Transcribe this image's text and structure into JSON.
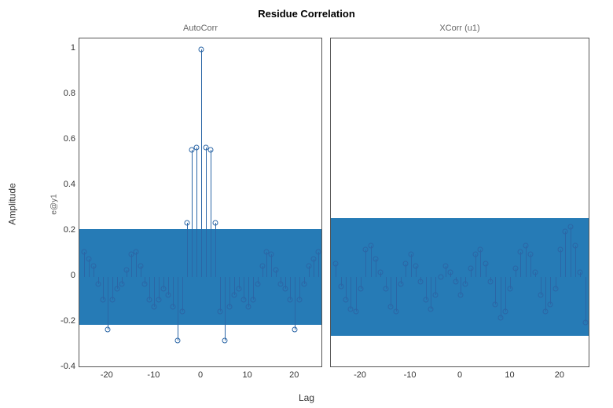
{
  "suptitle": "Residue Correlation",
  "ylabel_outer": "Amplitude",
  "ylabel_inner": "e@y1",
  "xlabel": "Lag",
  "subplots": {
    "left": {
      "title": "AutoCorr"
    },
    "right": {
      "title": "XCorr (u1)"
    }
  },
  "yticks": [
    {
      "v": -0.4,
      "label": "-0.4"
    },
    {
      "v": -0.2,
      "label": "-0.2"
    },
    {
      "v": 0.0,
      "label": "0"
    },
    {
      "v": 0.2,
      "label": "0.2"
    },
    {
      "v": 0.4,
      "label": "0.4"
    },
    {
      "v": 0.6,
      "label": "0.6"
    },
    {
      "v": 0.8,
      "label": "0.8"
    },
    {
      "v": 1.0,
      "label": "1"
    }
  ],
  "xticks": [
    {
      "v": -20,
      "label": "-20"
    },
    {
      "v": -10,
      "label": "-10"
    },
    {
      "v": 0,
      "label": "0"
    },
    {
      "v": 10,
      "label": "10"
    },
    {
      "v": 20,
      "label": "20"
    }
  ],
  "chart_data": [
    {
      "type": "stem",
      "title": "AutoCorr",
      "xlabel": "Lag",
      "ylabel": "Amplitude",
      "xlim": [
        -26,
        26
      ],
      "ylim": [
        -0.4,
        1.05
      ],
      "confidence_band": [
        -0.21,
        0.21
      ],
      "lags": [
        -25,
        -24,
        -23,
        -22,
        -21,
        -20,
        -19,
        -18,
        -17,
        -16,
        -15,
        -14,
        -13,
        -12,
        -11,
        -10,
        -9,
        -8,
        -7,
        -6,
        -5,
        -4,
        -3,
        -2,
        -1,
        0,
        1,
        2,
        3,
        4,
        5,
        6,
        7,
        8,
        9,
        10,
        11,
        12,
        13,
        14,
        15,
        16,
        17,
        18,
        19,
        20,
        21,
        22,
        23,
        24,
        25
      ],
      "values": [
        0.11,
        0.08,
        0.05,
        -0.03,
        -0.1,
        -0.23,
        -0.1,
        -0.05,
        -0.03,
        0.03,
        0.1,
        0.11,
        0.05,
        -0.03,
        -0.1,
        -0.13,
        -0.1,
        -0.05,
        -0.08,
        -0.13,
        -0.28,
        -0.15,
        0.24,
        0.56,
        0.57,
        1.0,
        0.57,
        0.56,
        0.24,
        -0.15,
        -0.28,
        -0.13,
        -0.08,
        -0.05,
        -0.1,
        -0.13,
        -0.1,
        -0.03,
        0.05,
        0.11,
        0.1,
        0.03,
        -0.03,
        -0.05,
        -0.1,
        -0.23,
        -0.1,
        -0.03,
        0.05,
        0.08,
        0.11
      ]
    },
    {
      "type": "stem",
      "title": "XCorr (u1)",
      "xlabel": "Lag",
      "ylabel": "Amplitude",
      "xlim": [
        -26,
        26
      ],
      "ylim": [
        -0.4,
        1.05
      ],
      "confidence_band": [
        -0.26,
        0.26
      ],
      "lags": [
        -25,
        -24,
        -23,
        -22,
        -21,
        -20,
        -19,
        -18,
        -17,
        -16,
        -15,
        -14,
        -13,
        -12,
        -11,
        -10,
        -9,
        -8,
        -7,
        -6,
        -5,
        -4,
        -3,
        -2,
        -1,
        0,
        1,
        2,
        3,
        4,
        5,
        6,
        7,
        8,
        9,
        10,
        11,
        12,
        13,
        14,
        15,
        16,
        17,
        18,
        19,
        20,
        21,
        22,
        23,
        24,
        25
      ],
      "values": [
        0.06,
        -0.04,
        -0.1,
        -0.14,
        -0.15,
        -0.05,
        0.12,
        0.14,
        0.08,
        0.02,
        -0.05,
        -0.13,
        -0.15,
        -0.03,
        0.06,
        0.1,
        0.05,
        -0.02,
        -0.1,
        -0.14,
        -0.08,
        0.0,
        0.05,
        0.02,
        -0.02,
        -0.08,
        -0.03,
        0.04,
        0.1,
        0.12,
        0.06,
        -0.02,
        -0.12,
        -0.18,
        -0.15,
        -0.05,
        0.04,
        0.11,
        0.14,
        0.1,
        0.02,
        -0.08,
        -0.15,
        -0.12,
        -0.05,
        0.12,
        0.2,
        0.22,
        0.14,
        0.02,
        -0.2
      ]
    }
  ]
}
